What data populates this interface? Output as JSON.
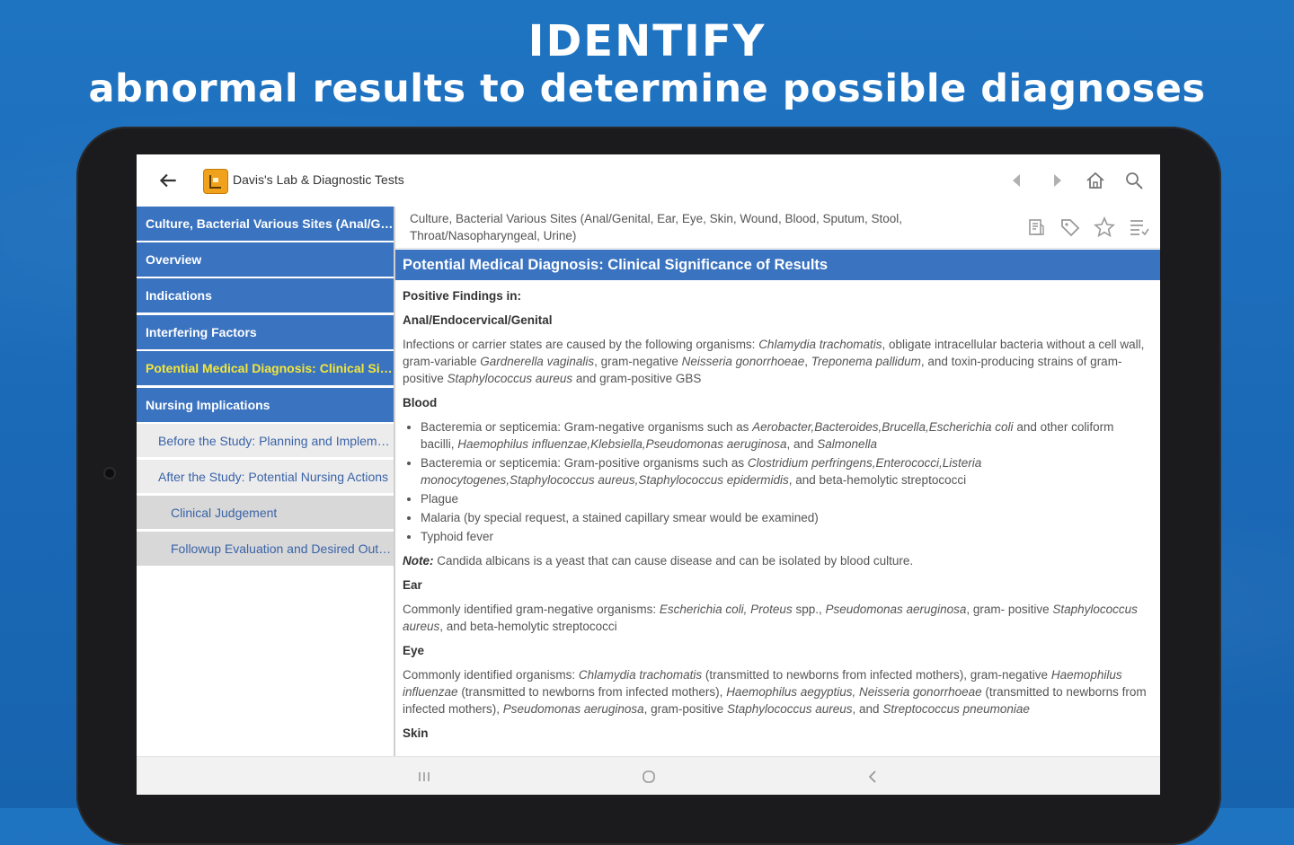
{
  "promo": {
    "headline": "IDENTIFY",
    "subheadline": "abnormal results to determine possible diagnoses"
  },
  "toolbar": {
    "app_title": "Davis's Lab & Diagnostic Tests",
    "icons": [
      "back-arrow-icon",
      "app-book-icon",
      "prev-icon",
      "next-icon",
      "home-icon",
      "search-icon"
    ]
  },
  "sidebar": {
    "items": [
      {
        "label": "Culture, Bacterial Various Sites (Anal/Genital, Ear, Eye, Skin, Wound, Blood, Sputum, Stool, Throat/Nasopharyngeal, Urine)",
        "level": 0
      },
      {
        "label": "Overview",
        "level": 0
      },
      {
        "label": "Indications",
        "level": 0
      },
      {
        "label": "Interfering Factors",
        "level": 0
      },
      {
        "label": "Potential Medical Diagnosis: Clinical Significance of Results",
        "level": 0,
        "active": true
      },
      {
        "label": "Nursing Implications",
        "level": 0
      },
      {
        "label": "Before the Study: Planning and Implementation",
        "level": 1
      },
      {
        "label": "After the Study: Potential Nursing Actions",
        "level": 1
      },
      {
        "label": "Clinical Judgement",
        "level": 2
      },
      {
        "label": "Followup Evaluation and Desired Outcomes",
        "level": 2
      }
    ]
  },
  "doc": {
    "title": "Culture, Bacterial Various Sites (Anal/Genital, Ear, Eye, Skin, Wound, Blood, Sputum, Stool, Throat/Nasopharyngeal, Urine)",
    "header_icons": [
      "notes-icon",
      "tag-icon",
      "star-icon",
      "table-of-contents-icon"
    ],
    "section_title": "Potential Medical Diagnosis: Clinical Significance of Results",
    "positive_findings": "Positive Findings in:",
    "anal_heading": "Anal/Endocervical/Genital",
    "anal_text_1": "Infections or carrier states are caused by the following organisms: ",
    "anal_text_2": "Chlamydia trachomatis",
    "anal_text_3": ", obligate intracellular bacteria without a cell wall, gram-variable ",
    "anal_text_4": "Gardnerella vaginalis",
    "anal_text_5": ", gram-negative ",
    "anal_text_6": "Neisseria gonorrhoeae",
    "anal_text_7": ", ",
    "anal_text_8": "Treponema pallidum",
    "anal_text_9": ", and toxin-producing strains of gram-positive ",
    "anal_text_10": "Staphylococcus aureus",
    "anal_text_11": " and gram-positive GBS",
    "blood_heading": "Blood",
    "blood_1a": "Bacteremia or septicemia: Gram-negative organisms such as ",
    "blood_1b": "Aerobacter,Bacteroides,Brucella,Escherichia coli",
    "blood_1c": " and other coliform bacilli, ",
    "blood_1d": "Haemophilus influenzae,Klebsiella,Pseudomonas aeruginosa",
    "blood_1e": ", and ",
    "blood_1f": "Salmonella",
    "blood_2a": "Bacteremia or septicemia: Gram-positive organisms such as ",
    "blood_2b": "Clostridium perfringens,Enterococci,Listeria monocytogenes,Staphylococcus aureus,Staphylococcus epidermidis",
    "blood_2c": ", and beta-hemolytic streptococci",
    "blood_3": "Plague",
    "blood_4": "Malaria (by special request, a stained capillary smear would be examined)",
    "blood_5": "Typhoid fever",
    "note_label": "Note:",
    "note_text": " Candida albicans is a yeast that can cause disease and can be isolated by blood culture.",
    "ear_heading": "Ear",
    "ear_1": "Commonly identified gram-negative organisms: ",
    "ear_2": "Escherichia coli, Proteus",
    "ear_3": " spp., ",
    "ear_4": "Pseudomonas aeruginosa",
    "ear_5": ", gram- positive ",
    "ear_6": "Staphylococcus aureus",
    "ear_7": ", and beta-hemolytic streptococci",
    "eye_heading": "Eye",
    "eye_1": "Commonly identified organisms: ",
    "eye_2": "Chlamydia trachomatis",
    "eye_3": " (transmitted to newborns from infected mothers), gram-negative ",
    "eye_4": "Haemophilus influenzae",
    "eye_5": " (transmitted to newborns from infected mothers), ",
    "eye_6": "Haemophilus aegyptius, Neisseria gonorrhoeae",
    "eye_7": " (transmitted to newborns from infected mothers), ",
    "eye_8": "Pseudomonas aeruginosa",
    "eye_9": ", gram-positive ",
    "eye_10": "Staphylococcus aureus",
    "eye_11": ", and ",
    "eye_12": "Streptococcus pneumoniae",
    "skin_heading": "Skin"
  },
  "bottom_nav": {
    "icons": [
      "recent-apps-icon",
      "home-circle-icon",
      "system-back-icon"
    ]
  },
  "colors": {
    "background": "#1a68b6",
    "accent": "#3a73c0",
    "active_text": "#f3e63a"
  }
}
